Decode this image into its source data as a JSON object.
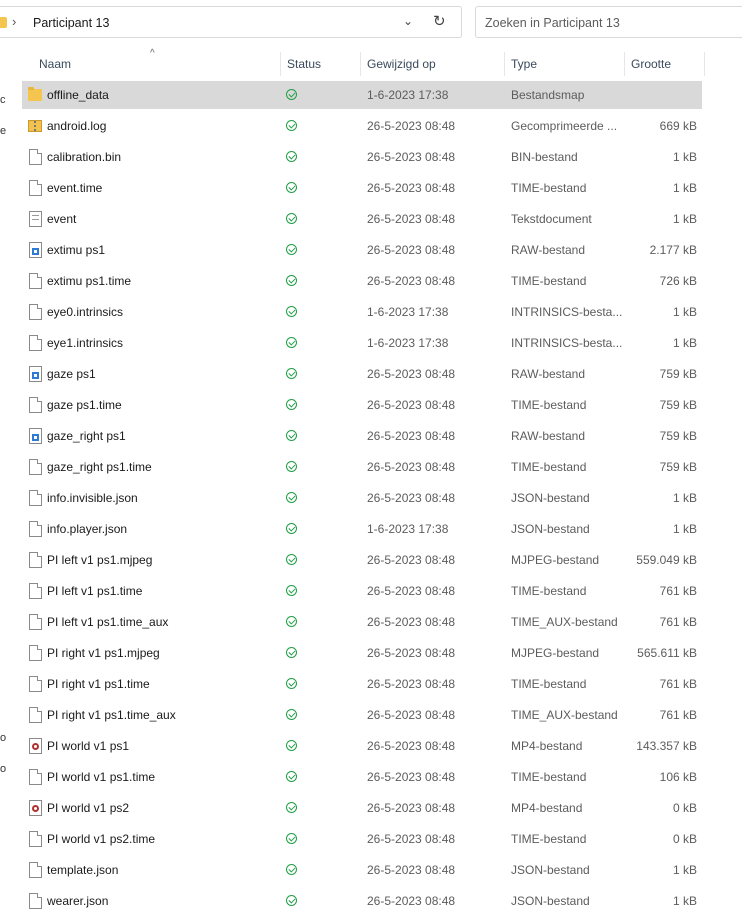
{
  "address_bar": {
    "crumb": "Participant 13",
    "search_placeholder": "Zoeken in Participant 13"
  },
  "columns": {
    "name": "Naam",
    "status": "Status",
    "modified": "Gewijzigd op",
    "type": "Type",
    "size": "Grootte"
  },
  "nav_glyphs": [
    "c",
    "e",
    "o",
    "o"
  ],
  "files": [
    {
      "name": "offline_data",
      "date": "1-6-2023 17:38",
      "type": "Bestandsmap",
      "size": "",
      "icon": "folder-icon",
      "selected": true
    },
    {
      "name": "android.log",
      "date": "26-5-2023 08:48",
      "type": "Gecomprimeerde ...",
      "size": "669 kB",
      "icon": "zip-folder-icon"
    },
    {
      "name": "calibration.bin",
      "date": "26-5-2023 08:48",
      "type": "BIN-bestand",
      "size": "1 kB",
      "icon": "file-icon"
    },
    {
      "name": "event.time",
      "date": "26-5-2023 08:48",
      "type": "TIME-bestand",
      "size": "1 kB",
      "icon": "file-icon"
    },
    {
      "name": "event",
      "date": "26-5-2023 08:48",
      "type": "Tekstdocument",
      "size": "1 kB",
      "icon": "text-document-icon"
    },
    {
      "name": "extimu ps1",
      "date": "26-5-2023 08:48",
      "type": "RAW-bestand",
      "size": "2.177 kB",
      "icon": "raw-image-icon"
    },
    {
      "name": "extimu ps1.time",
      "date": "26-5-2023 08:48",
      "type": "TIME-bestand",
      "size": "726 kB",
      "icon": "file-icon"
    },
    {
      "name": "eye0.intrinsics",
      "date": "1-6-2023 17:38",
      "type": "INTRINSICS-besta...",
      "size": "1 kB",
      "icon": "file-icon"
    },
    {
      "name": "eye1.intrinsics",
      "date": "1-6-2023 17:38",
      "type": "INTRINSICS-besta...",
      "size": "1 kB",
      "icon": "file-icon"
    },
    {
      "name": "gaze ps1",
      "date": "26-5-2023 08:48",
      "type": "RAW-bestand",
      "size": "759 kB",
      "icon": "raw-image-icon"
    },
    {
      "name": "gaze ps1.time",
      "date": "26-5-2023 08:48",
      "type": "TIME-bestand",
      "size": "759 kB",
      "icon": "file-icon"
    },
    {
      "name": "gaze_right ps1",
      "date": "26-5-2023 08:48",
      "type": "RAW-bestand",
      "size": "759 kB",
      "icon": "raw-image-icon"
    },
    {
      "name": "gaze_right ps1.time",
      "date": "26-5-2023 08:48",
      "type": "TIME-bestand",
      "size": "759 kB",
      "icon": "file-icon"
    },
    {
      "name": "info.invisible.json",
      "date": "26-5-2023 08:48",
      "type": "JSON-bestand",
      "size": "1 kB",
      "icon": "file-icon"
    },
    {
      "name": "info.player.json",
      "date": "1-6-2023 17:38",
      "type": "JSON-bestand",
      "size": "1 kB",
      "icon": "file-icon"
    },
    {
      "name": "PI left v1 ps1.mjpeg",
      "date": "26-5-2023 08:48",
      "type": "MJPEG-bestand",
      "size": "559.049 kB",
      "icon": "file-icon"
    },
    {
      "name": "PI left v1 ps1.time",
      "date": "26-5-2023 08:48",
      "type": "TIME-bestand",
      "size": "761 kB",
      "icon": "file-icon"
    },
    {
      "name": "PI left v1 ps1.time_aux",
      "date": "26-5-2023 08:48",
      "type": "TIME_AUX-bestand",
      "size": "761 kB",
      "icon": "file-icon"
    },
    {
      "name": "PI right v1 ps1.mjpeg",
      "date": "26-5-2023 08:48",
      "type": "MJPEG-bestand",
      "size": "565.611 kB",
      "icon": "file-icon"
    },
    {
      "name": "PI right v1 ps1.time",
      "date": "26-5-2023 08:48",
      "type": "TIME-bestand",
      "size": "761 kB",
      "icon": "file-icon"
    },
    {
      "name": "PI right v1 ps1.time_aux",
      "date": "26-5-2023 08:48",
      "type": "TIME_AUX-bestand",
      "size": "761 kB",
      "icon": "file-icon"
    },
    {
      "name": "PI world v1 ps1",
      "date": "26-5-2023 08:48",
      "type": "MP4-bestand",
      "size": "143.357 kB",
      "icon": "video-file-icon"
    },
    {
      "name": "PI world v1 ps1.time",
      "date": "26-5-2023 08:48",
      "type": "TIME-bestand",
      "size": "106 kB",
      "icon": "file-icon"
    },
    {
      "name": "PI world v1 ps2",
      "date": "26-5-2023 08:48",
      "type": "MP4-bestand",
      "size": "0 kB",
      "icon": "video-file-icon"
    },
    {
      "name": "PI world v1 ps2.time",
      "date": "26-5-2023 08:48",
      "type": "TIME-bestand",
      "size": "0 kB",
      "icon": "file-icon"
    },
    {
      "name": "template.json",
      "date": "26-5-2023 08:48",
      "type": "JSON-bestand",
      "size": "1 kB",
      "icon": "file-icon"
    },
    {
      "name": "wearer.json",
      "date": "26-5-2023 08:48",
      "type": "JSON-bestand",
      "size": "1 kB",
      "icon": "file-icon"
    }
  ],
  "colors": {
    "selected_row": "#d9d9d9",
    "status_ok": "#1f9f46",
    "folder": "#f5c64f"
  }
}
